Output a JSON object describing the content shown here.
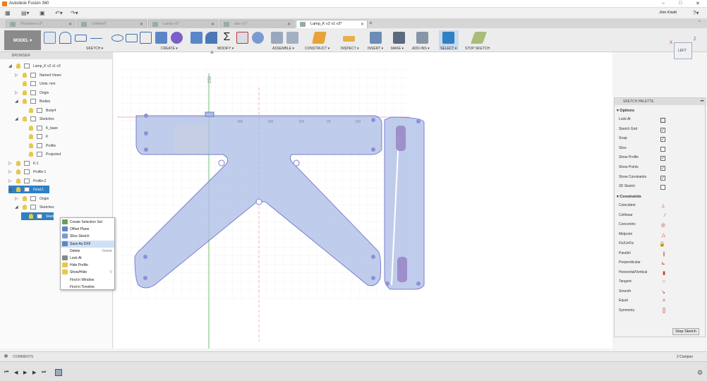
{
  "app": {
    "title": "Autodesk Fusion 360",
    "user": "Jöm Kiwitt"
  },
  "tabs": [
    {
      "label": "Photobot v3*",
      "active": false
    },
    {
      "label": "Untitled*",
      "active": false
    },
    {
      "label": "Lamp v1*",
      "active": false
    },
    {
      "label": "star v1*",
      "active": false
    },
    {
      "label": "Lamp_K v2 v1 v3*",
      "active": true
    }
  ],
  "toolbar": {
    "model": "MODEL ▾",
    "groups": [
      "SKETCH ▾",
      "CREATE ▾",
      "MODIFY ▾",
      "ASSEMBLE ▾",
      "CONSTRUCT ▾",
      "INSPECT ▾",
      "INSERT ▾",
      "MAKE ▾",
      "ADD-INS ▾",
      "SELECT ▾",
      "STOP SKETCH"
    ]
  },
  "browser": {
    "header": "BROWSER",
    "items": [
      "Lamp_K v2 v1 v3",
      "Named Views",
      "Units: mm",
      "Origin",
      "Bodies",
      "Body4",
      "Sketches",
      "K_base",
      "K",
      "Profile",
      "Projected",
      "K:1",
      "Profile:1",
      "Profile:2",
      "Final:1",
      "Origin",
      "Sketches",
      "Sketch1"
    ]
  },
  "context_menu": [
    {
      "label": "Create Selection Set",
      "shortcut": ""
    },
    {
      "label": "Offset Plane",
      "shortcut": ""
    },
    {
      "label": "Slice Sketch",
      "shortcut": ""
    },
    {
      "label": "Save As DXF",
      "shortcut": ""
    },
    {
      "label": "Delete",
      "shortcut": "Delete"
    },
    {
      "label": "Look At",
      "shortcut": ""
    },
    {
      "label": "Hide Profile",
      "shortcut": ""
    },
    {
      "label": "Show/Hide",
      "shortcut": "V"
    },
    {
      "label": "Find in Window",
      "shortcut": ""
    },
    {
      "label": "Find in Timeline",
      "shortcut": ""
    }
  ],
  "canvas": {
    "dim_top": "250",
    "dims": [
      "100",
      "150",
      "20",
      "150",
      "300"
    ],
    "viewcube": "LEFT",
    "axis_x": "X",
    "axis_z": "Z"
  },
  "palette": {
    "header": "SKETCH PALETTE",
    "options_label": "Options",
    "options": [
      {
        "label": "Look At",
        "state": "icon"
      },
      {
        "label": "Sketch Grid",
        "state": "✓"
      },
      {
        "label": "Snap",
        "state": "✓"
      },
      {
        "label": "Slice",
        "state": ""
      },
      {
        "label": "Show Profile",
        "state": "✓"
      },
      {
        "label": "Show Points",
        "state": "✓"
      },
      {
        "label": "Show Constraints",
        "state": "✓"
      },
      {
        "label": "3D Sketch",
        "state": ""
      }
    ],
    "constraints_label": "Constraints",
    "constraints": [
      "Coincident",
      "Collinear",
      "Concentric",
      "Midpoint",
      "Fix/UnFix",
      "Parallel",
      "Perpendicular",
      "Horizontal/Vertical",
      "Tangent",
      "Smooth",
      "Equal",
      "Symmetry"
    ],
    "stop": "Stop Sketch"
  },
  "comments": "COMMENTS",
  "status": "2 Compon",
  "colors": {
    "sketch_fill": "#aebee6",
    "sketch_stroke": "#7a7fd0",
    "accent": "#1f78c8"
  }
}
